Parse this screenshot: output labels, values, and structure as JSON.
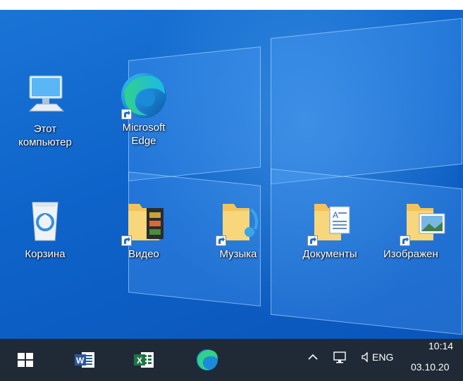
{
  "desktop": {
    "icons": [
      {
        "label": "Этот\nкомпьютер",
        "icon": "computer-icon"
      },
      {
        "label": "Microsoft\nEdge",
        "icon": "edge-icon"
      },
      {
        "label": "Корзина",
        "icon": "recycle-bin-icon"
      },
      {
        "label": "Видео",
        "icon": "video-folder-icon"
      },
      {
        "label": "Музыка",
        "icon": "music-folder-icon"
      },
      {
        "label": "Документы",
        "icon": "documents-folder-icon"
      },
      {
        "label": "Изображен",
        "icon": "pictures-folder-icon"
      }
    ]
  },
  "taskbar": {
    "pinned": [
      {
        "name": "start-button",
        "icon": "windows-logo-icon"
      },
      {
        "name": "word",
        "icon": "word-icon"
      },
      {
        "name": "excel",
        "icon": "excel-icon"
      },
      {
        "name": "edge",
        "icon": "edge-icon"
      }
    ],
    "tray": {
      "language": "ENG",
      "time": "10:14",
      "date": "03.10.20"
    }
  }
}
